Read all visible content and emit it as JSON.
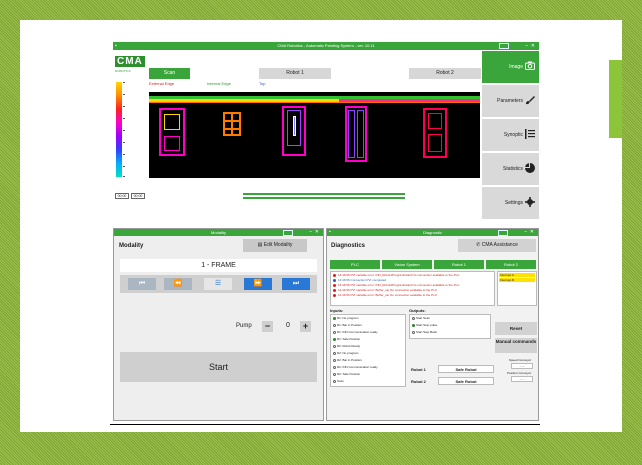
{
  "main_window": {
    "title": "CMA Robotics - Automatic Painting System - ver. 10.11",
    "logo": "CMA",
    "logo_sub": "ROBOTICS",
    "tabs": [
      "Scan",
      "Robot 1",
      "Robot 2"
    ],
    "legend": {
      "external": "External Edge",
      "internal": "Internal Edge",
      "top": "Top"
    },
    "time_left": "00:00",
    "time_right": "00:00",
    "sidebar": [
      {
        "label": "Image",
        "icon": "camera-icon",
        "active": true
      },
      {
        "label": "Parameters",
        "icon": "brush-icon",
        "active": false
      },
      {
        "label": "Synoptic",
        "icon": "list-icon",
        "active": false
      },
      {
        "label": "Statistics",
        "icon": "pie-chart-icon",
        "active": false
      },
      {
        "label": "Settings",
        "icon": "gear-icon",
        "active": false
      }
    ]
  },
  "modality_window": {
    "window_title": "Modality",
    "title": "Modality",
    "edit_button": "Edit Modality",
    "frame_name": "1 - FRAME",
    "pump_label": "Pump",
    "pump_minus": "−",
    "pump_value": "0",
    "pump_plus": "+",
    "start_button": "Start"
  },
  "diagnostics_window": {
    "window_title": "Diagnostic",
    "title": "Diagnostics",
    "assistance_button": "CMA Assistance",
    "tabs": [
      "PLC",
      "Vision System",
      "Robot 1",
      "Robot 2"
    ],
    "log": [
      {
        "time": "14:46:56",
        "text": "PVI variable error: INN_Robot1ProgramFailed No connection available to the PLC",
        "color": "#d62020"
      },
      {
        "time": "14:46:56",
        "text": "Connection PVI completed",
        "color": "#2a5db0"
      },
      {
        "time": "14:46:56",
        "text": "PVI variable error: INN_Robot2ProgramFailed No connection available to the PLC",
        "color": "#d62020"
      },
      {
        "time": "14:46:56",
        "text": "PVI variable error: Buffer_var No connection available to the PLC",
        "color": "#d62020"
      },
      {
        "time": "14:46:56",
        "text": "PVI variable error: Buffer_var No connection available to the PLC",
        "color": "#d62020"
      }
    ],
    "warnings": [
      "Interrupt A",
      "Interrupt B"
    ],
    "inputs_label": "Inputs:",
    "outputs_label": "Outputs:",
    "inputs": [
      {
        "text": "R1: No program",
        "on": true
      },
      {
        "text": "R1: Bar in Position",
        "on": false
      },
      {
        "text": "R1: INN Communication ready",
        "on": false
      },
      {
        "text": "R1: Safe Position",
        "on": true
      },
      {
        "text": "R2: Robot Ready",
        "on": false
      },
      {
        "text": "R2: No program",
        "on": false
      },
      {
        "text": "R2: Bar in Position",
        "on": false
      },
      {
        "text": "R2: INN Communication ready",
        "on": false
      },
      {
        "text": "R2: Safe Position",
        "on": false
      },
      {
        "text": "Scan",
        "on": false
      }
    ],
    "outputs": [
      {
        "text": "Start Scan",
        "on": false
      },
      {
        "text": "Start Stop pulse",
        "on": true
      },
      {
        "text": "Start Step Back",
        "on": false
      }
    ],
    "reset_button": "Reset",
    "manual_button": "Manual commands",
    "speed_conveyor_label": "Speed Conveyor",
    "position_conveyor_label": "Position Conveyor",
    "speed_value": "- - -",
    "position_value": "- - -",
    "robot1_label": "Robot 1",
    "robot2_label": "Robot 2",
    "safe_robot_label": "Safe Robot"
  },
  "colors": {
    "brand_green": "#3aa53a",
    "button_grey": "#d9d9d9",
    "nav_blue": "#2a78d6"
  }
}
